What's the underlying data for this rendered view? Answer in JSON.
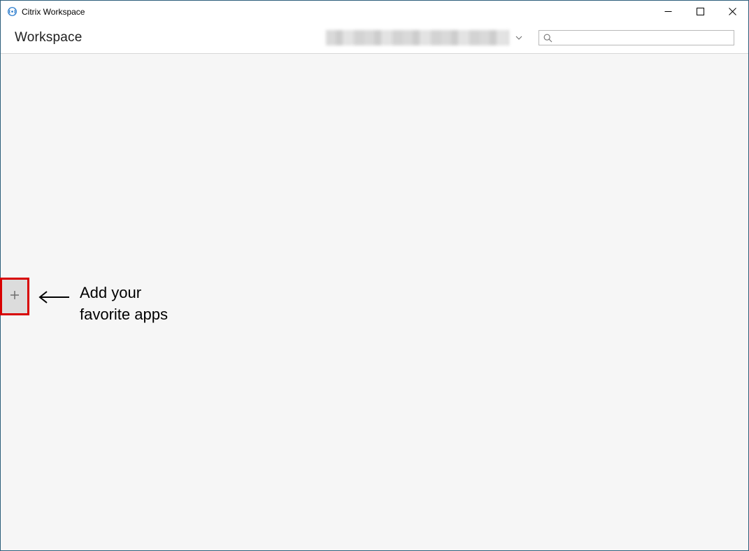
{
  "window": {
    "title": "Citrix Workspace"
  },
  "header": {
    "title": "Workspace",
    "search_placeholder": ""
  },
  "annotation": {
    "line1": "Add your",
    "line2": "favorite apps"
  }
}
